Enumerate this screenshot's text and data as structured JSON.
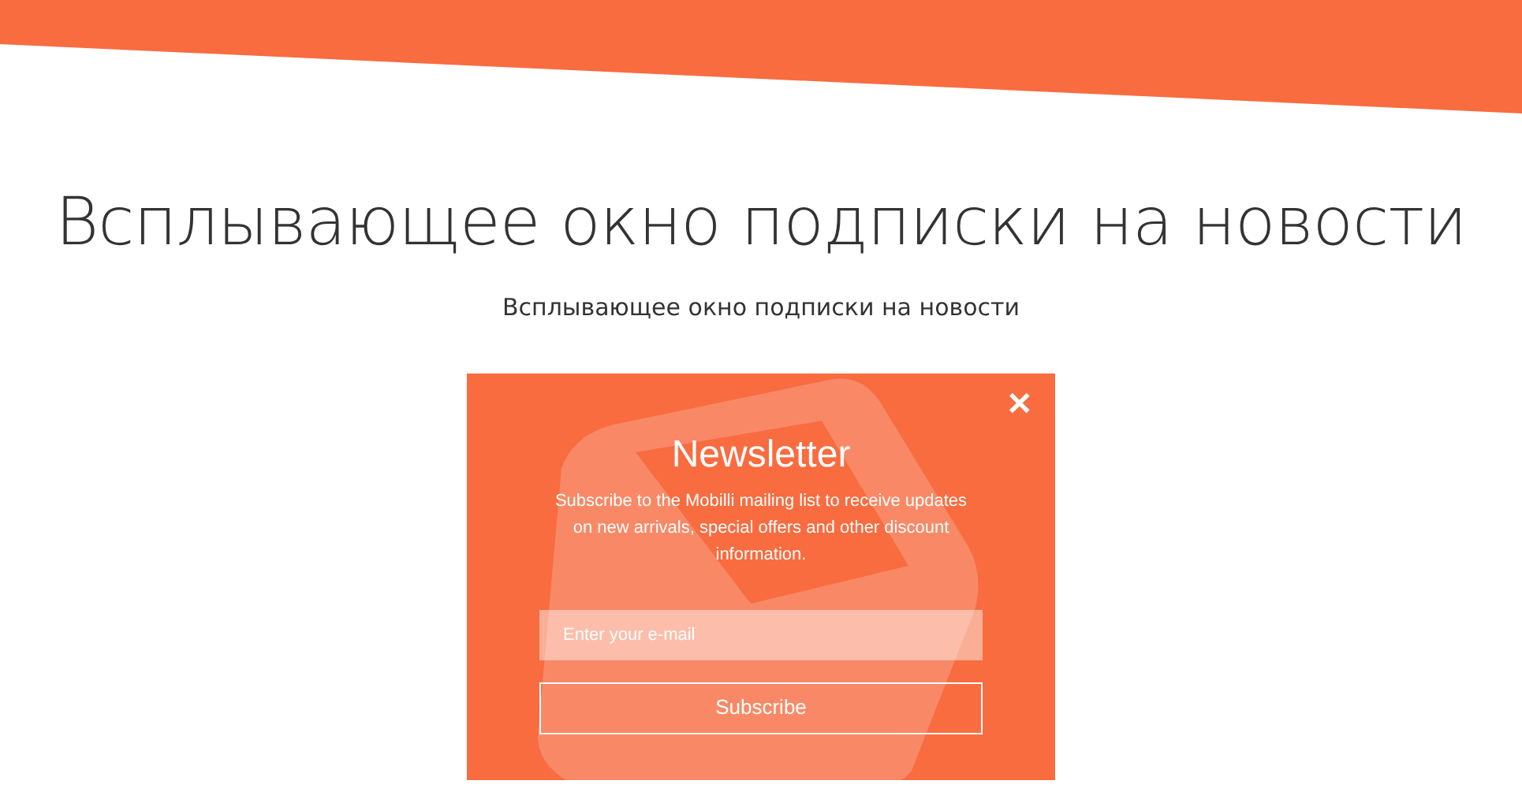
{
  "page": {
    "heading": "Всплывающее окно подписки на новости",
    "subheading": "Всплывающее окно подписки на новости"
  },
  "popup": {
    "close": "✕",
    "title": "Newsletter",
    "description": "Subscribe to the Mobilli mailing list to receive updates on new arrivals, special offers and other discount information.",
    "email": {
      "placeholder": "Enter your e-mail"
    },
    "button": "Subscribe"
  }
}
